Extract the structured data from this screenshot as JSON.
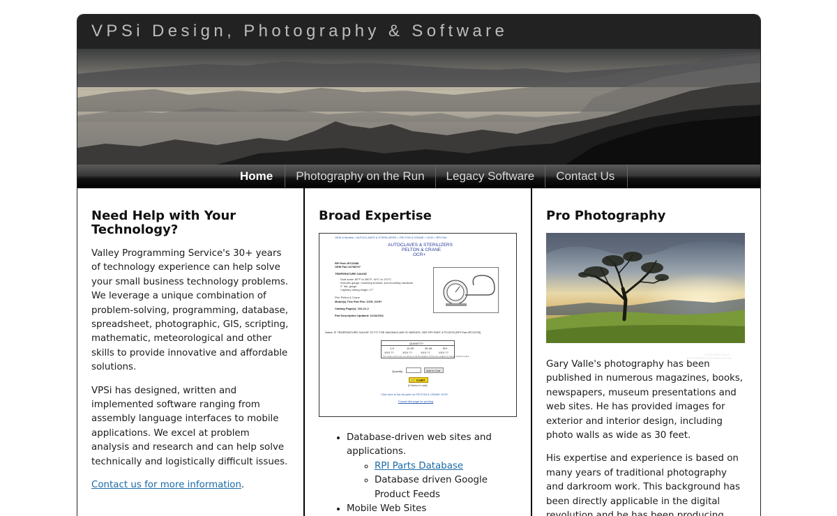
{
  "header": {
    "site_title": "VPSi Design, Photography & Software"
  },
  "nav": {
    "items": [
      {
        "label": "Home",
        "active": true
      },
      {
        "label": "Photography on the Run",
        "active": false
      },
      {
        "label": "Legacy Software",
        "active": false
      },
      {
        "label": "Contact Us",
        "active": false
      }
    ]
  },
  "col1": {
    "heading": "Need Help with Your Technology?",
    "para1": "Valley Programming Service's 30+ years of technology experience can help solve your small business technology problems. We leverage a unique combination of problem-solving, programming, database, spreadsheet, photographic, GIS, scripting, mathematic, meteorological and other skills to provide innovative and affordable solutions.",
    "para2": "VPSi has designed, written and implemented software ranging from assembly language interfaces to mobile applications. We excel at problem analysis and research and can help solve technically and logistically difficult issues.",
    "contact_link": "Contact us for more information",
    "contact_suffix": "."
  },
  "col2": {
    "heading": "Broad Expertise",
    "screenshot": {
      "breadcrumb": "OEM & Models > AUTOCLAVES & STERILIZERS > PELTON & CRANE > OCR > RPI Part",
      "title1": "AUTOCLAVES & STERILIZERS",
      "title2": "PELTON & CRANE",
      "title3": "OCR+",
      "part_line1": "RPI Part #PCG058",
      "part_line2": "OEM Part #6768767",
      "temp_heading": "TEMPERATURE GAUGE",
      "bullets": [
        "Dual scale: 80°F to 350°F, 40°C to 170°C",
        "Includes gauge, mounting bracket, and mounting hardware",
        "2\" dia. gauge",
        "Capillary tubing length: 17\""
      ],
      "fits": "Fits: Pelton & Crane",
      "models": "Model(s) This Part Fits: OCR, OCR+",
      "catalog": "Catalog Page(s): 104-21-2",
      "updated": "Part Description Updated: 11/16/2011",
      "notes": "Notes: IF TEMPERATURE GAUGE TO FIT THE MAGNACLAVE IS NEEDED, SEE RPI PART # PCG078 (RPI Part #PCG078)",
      "qty_header": "QUANTITY",
      "qty_cols": [
        "1-9",
        "10-29",
        "30-49",
        "50+"
      ],
      "qty_vals": [
        "XXX.??",
        "XXX.??",
        "XXX.??",
        "XXX.??"
      ],
      "qty_note": "Our online prices are our prices to all US dealers. Prices are subject to change without notice.",
      "quantity_label": "Quantity:",
      "add_to_cart": "Add to Cart",
      "cart_button": "CART",
      "cart_items": "(0 items in cart)",
      "list_all": "Click here to list all parts for PELTON & CRANE OCR+",
      "format": "Format this page for printing"
    },
    "list": [
      {
        "text": "Database-driven web sites and applications.",
        "sub": [
          {
            "text": "RPI Parts Database",
            "link": true
          },
          {
            "text": "Database driven Google Product Feeds",
            "link": false
          }
        ]
      },
      {
        "text": "Mobile Web Sites",
        "sub": []
      }
    ]
  },
  "col3": {
    "heading": "Pro Photography",
    "photo_watermark": "© 2011 GARY VALLE PHOTOGRAPHYONTHERUN.COM",
    "para1": "Gary Valle's photography has been published in numerous magazines, books, newspapers, museum presentations and web sites. He has provided images for exterior and interior design, including photo walls as wide as 30 feet.",
    "para2": "His expertise and experience is based on many years of traditional photography and darkroom work. This background has been directly applicable in the digital revolution and he has been producing digital fine art prints using the"
  }
}
